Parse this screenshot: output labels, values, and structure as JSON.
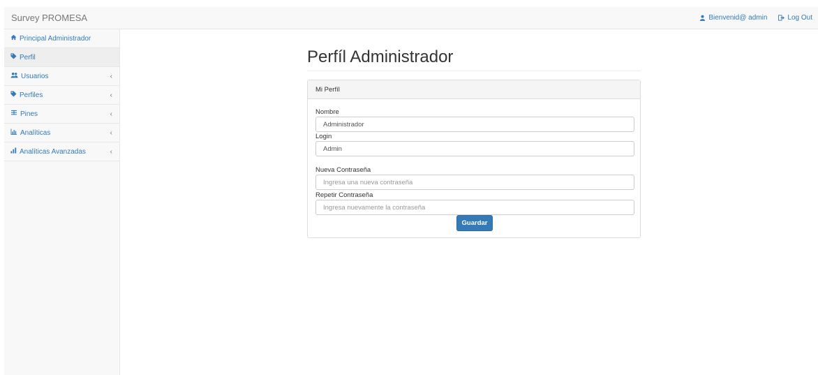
{
  "navbar": {
    "brand": "Survey PROMESA",
    "user_label": "Bienvenid@ admin",
    "logout_label": "Log Out"
  },
  "sidebar": {
    "items": [
      {
        "label": "Principal Administrador",
        "icon": "home-icon",
        "active": false,
        "has_chevron": false
      },
      {
        "label": "Perfil",
        "icon": "tag-icon",
        "active": true,
        "has_chevron": false
      },
      {
        "label": "Usuarios",
        "icon": "users-icon",
        "active": false,
        "has_chevron": true
      },
      {
        "label": "Perfiles",
        "icon": "tag-icon",
        "active": false,
        "has_chevron": true
      },
      {
        "label": "Pines",
        "icon": "barcode-icon",
        "active": false,
        "has_chevron": true
      },
      {
        "label": "Analíticas",
        "icon": "bar-chart-icon",
        "active": false,
        "has_chevron": true
      },
      {
        "label": "Analíticas Avanzadas",
        "icon": "signal-icon",
        "active": false,
        "has_chevron": true
      }
    ],
    "chevron": "‹"
  },
  "main": {
    "title": "Perfíl Administrador",
    "panel": {
      "heading": "Mi Perfíl",
      "nombre_label": "Nombre",
      "nombre_value": "Administrador",
      "login_label": "Login",
      "login_value": "Admin",
      "nueva_label": "Nueva Contraseña",
      "nueva_placeholder": "Ingresa una nueva contraseña",
      "repetir_label": "Repetir Contraseña",
      "repetir_placeholder": "Ingresa nuevamente la contraseña",
      "save_label": "Guardar"
    }
  },
  "colors": {
    "link": "#337ab7",
    "button": "#337ab7",
    "navbar_bg": "#f8f8f8"
  }
}
